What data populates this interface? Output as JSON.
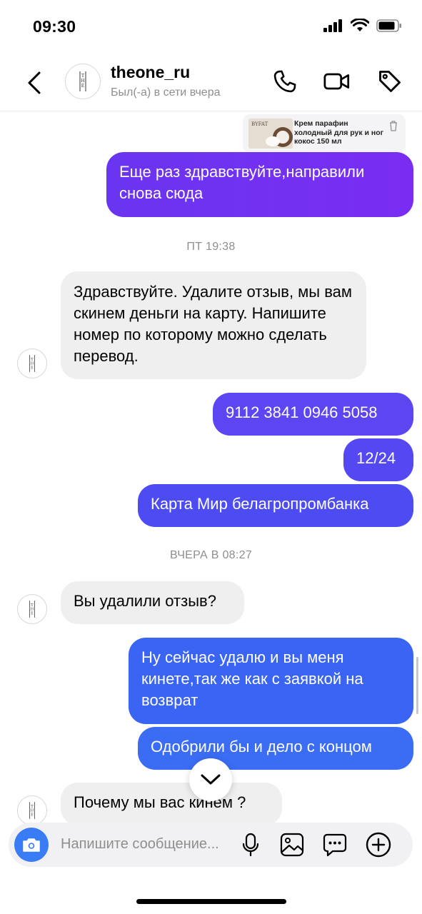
{
  "status_bar": {
    "time": "09:30",
    "icons": [
      "signal-icon",
      "wifi-icon",
      "battery-icon"
    ]
  },
  "header": {
    "username": "theone_ru",
    "presence": "Был(-а) в сети вчера",
    "avatar_logo_text": "THE ONE",
    "icons": [
      "back-arrow-icon",
      "phone-icon",
      "video-camera-icon",
      "tag-icon"
    ]
  },
  "product": {
    "title": "Крем парафин холодный для рук и ног кокос 150 мл",
    "thumb_brand": "BYFAT"
  },
  "conversation": {
    "timestamps": [
      "ПТ 19:38",
      "ВЧЕРА В 08:27"
    ],
    "messages": [
      {
        "from": "me",
        "text": "Еще раз здравствуйте,направили снова сюда"
      },
      {
        "from": "them",
        "text": "Здравствуйте. Удалите отзыв, мы вам скинем деньги на карту. Напишите номер по которому можно сделать перевод."
      },
      {
        "from": "me",
        "text": "9112 3841 0946 5058"
      },
      {
        "from": "me",
        "text": "12/24"
      },
      {
        "from": "me",
        "text": "Карта Мир белагропромбанка"
      },
      {
        "from": "them",
        "text": "Вы удалили отзыв?"
      },
      {
        "from": "me",
        "text": "Ну сейчас удалю и вы меня кинете,так же как с заявкой на возврат"
      },
      {
        "from": "me",
        "text": "Одобрили бы и дело с концом"
      },
      {
        "from": "them",
        "text": "Почему мы вас кинем ?"
      }
    ]
  },
  "composer": {
    "placeholder": "Напишите сообщение...",
    "icons": [
      "camera-icon",
      "microphone-icon",
      "gallery-icon",
      "sticker-chat-icon",
      "plus-icon"
    ]
  },
  "colors": {
    "bubble_purple": "#7a2df2",
    "bubble_indigo": "#5448f2",
    "bubble_blue": "#3a6df4",
    "incoming_bubble": "#efefef",
    "camera_button": "#3a7cf5"
  }
}
